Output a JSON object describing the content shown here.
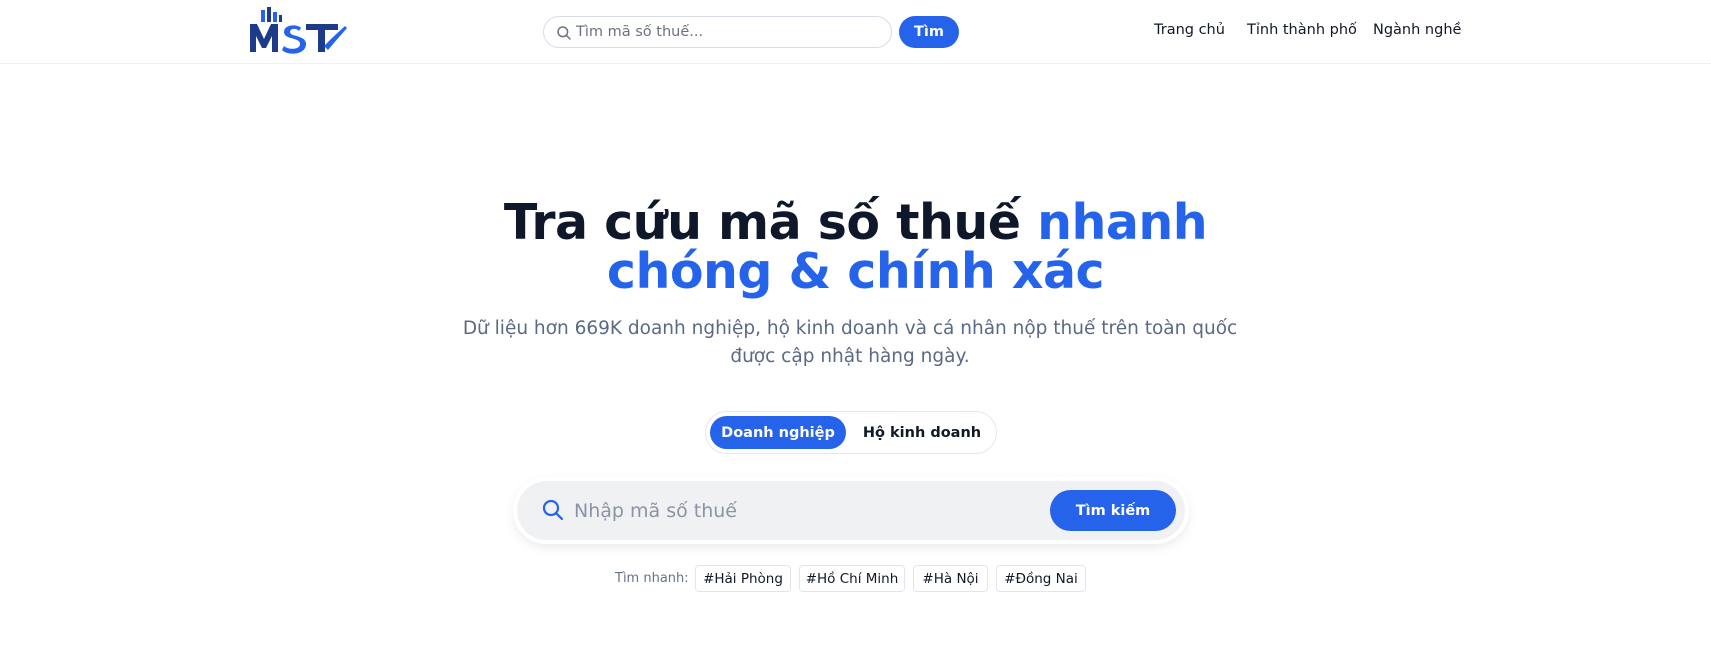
{
  "brand": {
    "logo_text": "MST",
    "primary_color": "#2563eb",
    "dark_color": "#1e3a8a"
  },
  "header": {
    "search": {
      "placeholder": "Tìm mã số thuế...",
      "value": ""
    },
    "search_button": "Tìm",
    "nav": [
      "Trang chủ",
      "Tỉnh thành phố",
      "Ngành nghề"
    ]
  },
  "hero": {
    "title_part1": "Tra cứu mã số thuế ",
    "title_highlight_1": "nhanh",
    "title_highlight_2": "chóng & chính xác",
    "subtitle": "Dữ liệu hơn 669K doanh nghiệp, hộ kinh doanh và cá nhân nộp thuế trên toàn quốc được cập nhật hàng ngày."
  },
  "toggle": {
    "options": [
      "Doanh nghiệp",
      "Hộ kinh doanh"
    ],
    "selected": "Doanh nghiệp"
  },
  "main_search": {
    "placeholder": "Nhập mã số thuế",
    "value": "",
    "button": "Tìm kiếm"
  },
  "quick_search": {
    "label": "Tìm nhanh:",
    "tags": [
      "#Hải Phòng",
      "#Hồ Chí Minh",
      "#Hà Nội",
      "#Đồng Nai"
    ]
  },
  "icons": [
    "search-icon"
  ]
}
